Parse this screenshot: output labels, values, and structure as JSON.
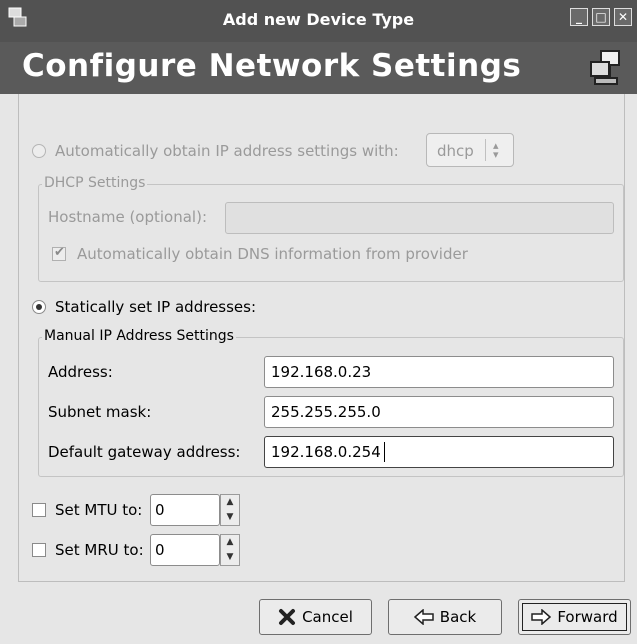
{
  "window": {
    "title": "Add new Device Type"
  },
  "banner": {
    "heading": "Configure Network Settings"
  },
  "auto_ip": {
    "label": "Automatically obtain IP address settings with:",
    "protocol": "dhcp"
  },
  "dhcp": {
    "legend": "DHCP Settings",
    "hostname_label": "Hostname (optional):",
    "hostname_value": "",
    "dns_label": "Automatically obtain DNS information from provider",
    "dns_checked": true
  },
  "static_ip": {
    "label": "Statically set IP addresses:",
    "selected": true
  },
  "manual": {
    "legend": "Manual IP Address Settings",
    "address_label": "Address:",
    "address_value": "192.168.0.23",
    "subnet_label": "Subnet mask:",
    "subnet_value": "255.255.255.0",
    "gateway_label": "Default gateway address:",
    "gateway_value": "192.168.0.254"
  },
  "mtu": {
    "label": "Set MTU to:",
    "value": "0",
    "checked": false
  },
  "mru": {
    "label": "Set MRU to:",
    "value": "0",
    "checked": false
  },
  "buttons": {
    "cancel": "Cancel",
    "back": "Back",
    "forward": "Forward"
  },
  "icons": {
    "window_app": "network-device-icon",
    "banner": "network-computers-icon",
    "cancel": "x-icon",
    "back": "back-arrow-icon",
    "forward": "forward-arrow-icon"
  },
  "colors": {
    "titlebar": "#525252",
    "banner": "#5a5a5a",
    "background": "#e6e6e6"
  }
}
